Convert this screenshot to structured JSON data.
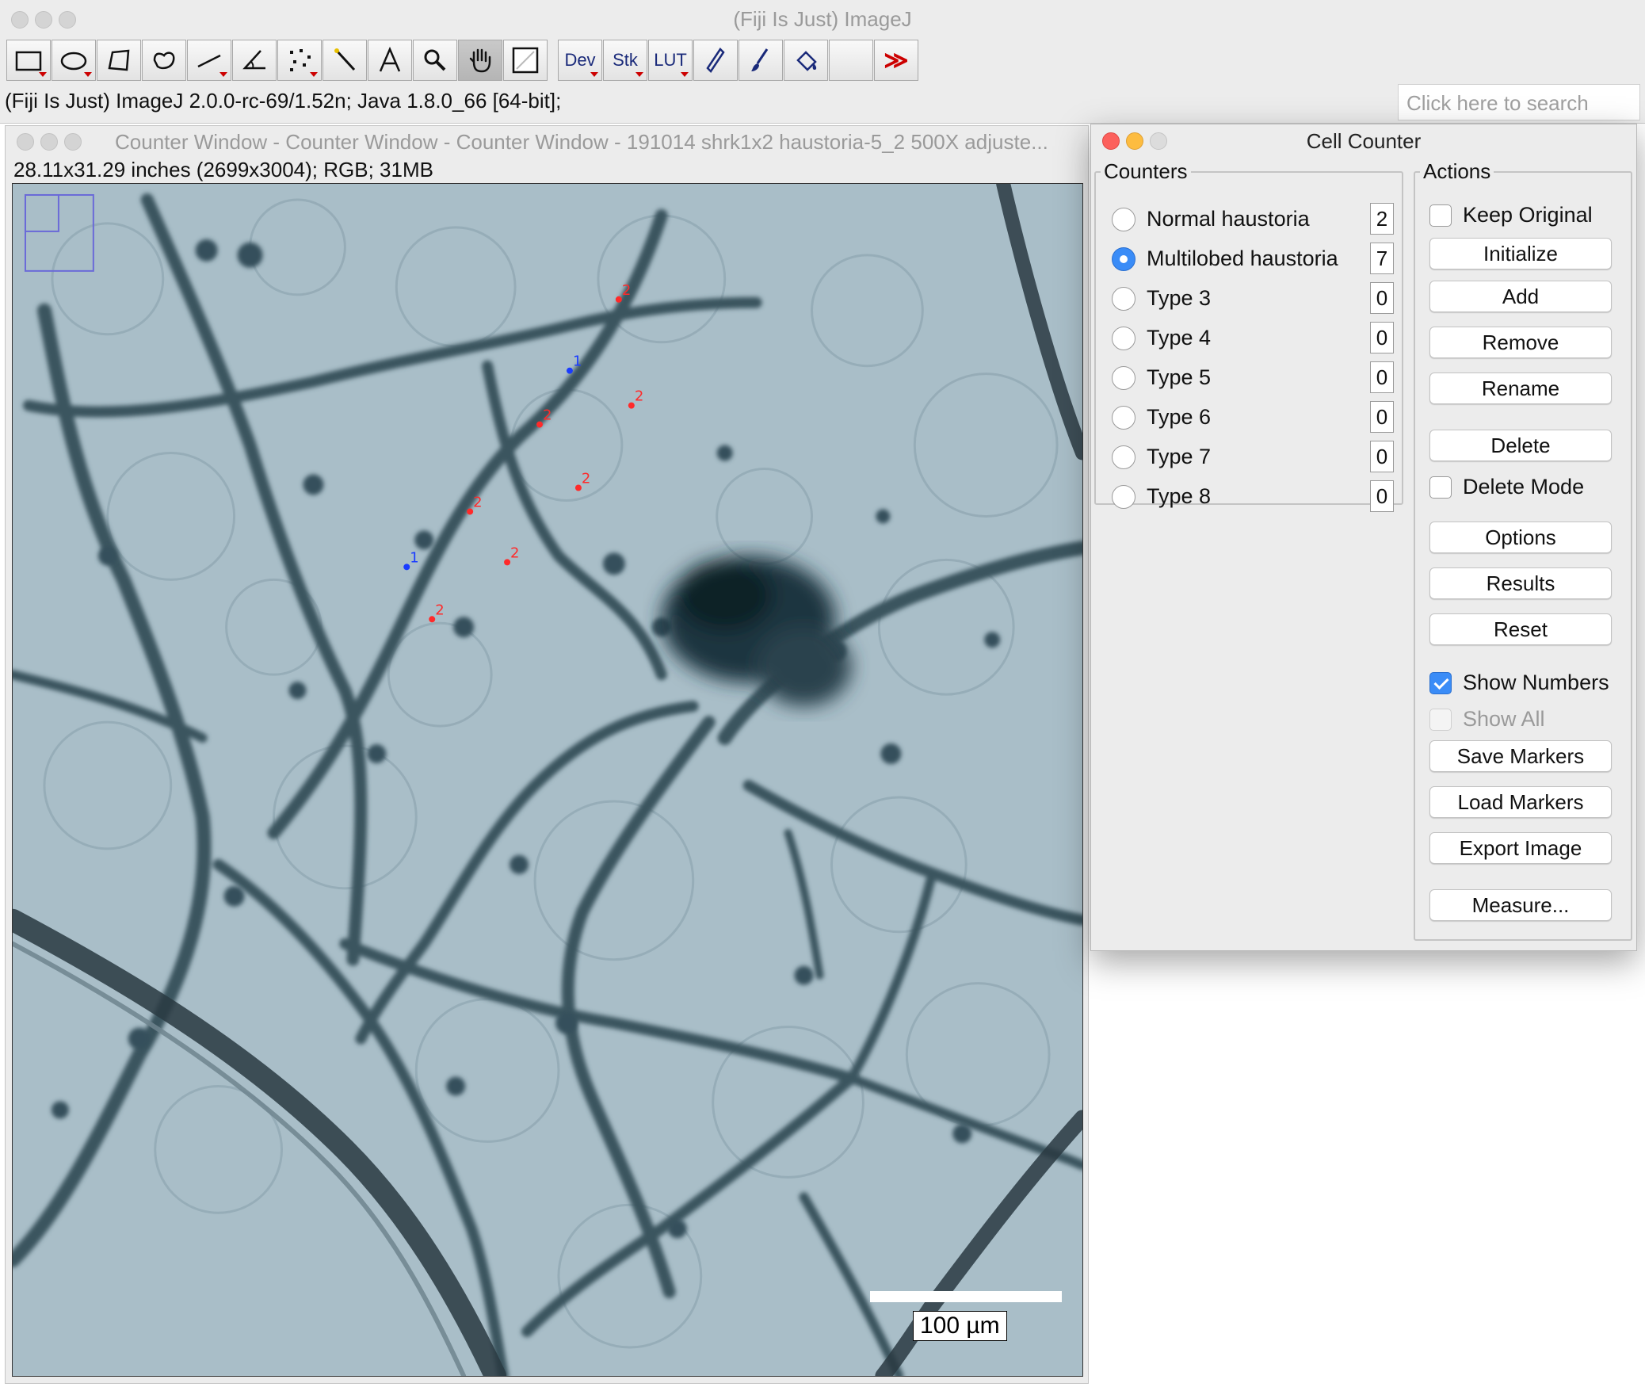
{
  "main_window": {
    "title": "(Fiji Is Just) ImageJ",
    "status": "(Fiji Is Just) ImageJ 2.0.0-rc-69/1.52n; Java 1.8.0_66 [64-bit];",
    "search_placeholder": "Click here to search",
    "toolbar": {
      "tools": [
        "rectangle-icon",
        "oval-icon",
        "polygon-icon",
        "freehand-icon",
        "line-icon",
        "angle-icon",
        "multipoint-icon",
        "wand-icon",
        "text-icon",
        "magnifier-icon",
        "hand-icon",
        "color-picker-icon"
      ],
      "dev_label": "Dev",
      "stk_label": "Stk",
      "lut_label": "LUT",
      "more_label": "≫",
      "extra_tools": [
        "pencil-icon",
        "brush-icon",
        "flood-fill-icon"
      ]
    }
  },
  "image_window": {
    "title": "Counter Window - Counter Window - Counter Window - 191014 shrk1x2 haustoria-5_2 500X adjuste...",
    "info": "28.11x31.29 inches (2699x3004); RGB; 31MB",
    "scale_label": "100 µm",
    "marker_colors": {
      "type1": "#1a3cff",
      "type2": "#ff2a2a"
    }
  },
  "cell_counter": {
    "title": "Cell Counter",
    "counters_legend": "Counters",
    "actions_legend": "Actions",
    "counters": [
      {
        "name": "Normal haustoria",
        "value": "2",
        "selected": false
      },
      {
        "name": "Multilobed haustoria",
        "value": "7",
        "selected": true
      },
      {
        "name": "Type 3",
        "value": "0",
        "selected": false
      },
      {
        "name": "Type 4",
        "value": "0",
        "selected": false
      },
      {
        "name": "Type 5",
        "value": "0",
        "selected": false
      },
      {
        "name": "Type 6",
        "value": "0",
        "selected": false
      },
      {
        "name": "Type 7",
        "value": "0",
        "selected": false
      },
      {
        "name": "Type 8",
        "value": "0",
        "selected": false
      }
    ],
    "keep_original": "Keep Original",
    "initialize": "Initialize",
    "add": "Add",
    "remove": "Remove",
    "rename": "Rename",
    "delete": "Delete",
    "delete_mode": "Delete Mode",
    "options": "Options",
    "results": "Results",
    "reset": "Reset",
    "show_numbers": "Show Numbers",
    "show_all": "Show All",
    "save_markers": "Save Markers",
    "load_markers": "Load Markers",
    "export_image": "Export Image",
    "measure": "Measure..."
  },
  "markers": [
    {
      "label": "1"
    },
    {
      "label": "1"
    },
    {
      "label": "2"
    },
    {
      "label": "2"
    },
    {
      "label": "2"
    },
    {
      "label": "2"
    },
    {
      "label": "2"
    },
    {
      "label": "2"
    },
    {
      "label": "2"
    }
  ]
}
